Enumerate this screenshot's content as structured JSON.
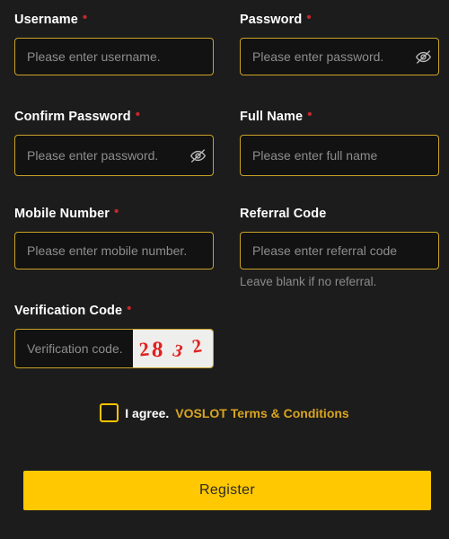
{
  "theme": {
    "page_background": "#1c1c1c",
    "input_background": "#121212",
    "border_gold": "#c9a227",
    "accent_gold": "#ffc400",
    "button_gold": "#ffc800",
    "required_red": "#c62828",
    "captcha_red": "#e02020",
    "captcha_background": "#eeeeec",
    "placeholder_gray": "#8d8d8d",
    "helper_gray": "#8a8a8a"
  },
  "form": {
    "fields": [
      {
        "name": "username",
        "label": "Username",
        "required": true,
        "required_marker": "•",
        "placeholder": "Please enter username.",
        "value": "",
        "has_toggle": false,
        "helper": ""
      },
      {
        "name": "password",
        "label": "Password",
        "required": true,
        "required_marker": "•",
        "placeholder": "Please enter password.",
        "value": "",
        "has_toggle": true,
        "toggle_icon": "eye-slash-icon",
        "helper": ""
      },
      {
        "name": "confirm-password",
        "label": "Confirm Password",
        "required": true,
        "required_marker": "•",
        "placeholder": "Please enter password.",
        "value": "",
        "has_toggle": true,
        "toggle_icon": "eye-slash-icon",
        "helper": ""
      },
      {
        "name": "full-name",
        "label": "Full Name",
        "required": true,
        "required_marker": "•",
        "placeholder": "Please enter full name",
        "value": "",
        "has_toggle": false,
        "helper": ""
      },
      {
        "name": "mobile-number",
        "label": "Mobile Number",
        "required": true,
        "required_marker": "•",
        "placeholder": "Please enter mobile number.",
        "value": "",
        "has_toggle": false,
        "helper": ""
      },
      {
        "name": "referral-code",
        "label": "Referral Code",
        "required": false,
        "required_marker": "",
        "placeholder": "Please enter referral code",
        "value": "",
        "has_toggle": false,
        "helper": "Leave blank if no referral."
      }
    ],
    "verification": {
      "label": "Verification Code",
      "required": true,
      "required_marker": "•",
      "placeholder": "Verification code.",
      "value": "",
      "captcha": {
        "text": "2832",
        "digits": [
          "2",
          "8",
          "3",
          "2"
        ]
      }
    },
    "agreement": {
      "checked": false,
      "prefix": "I agree.",
      "link_label": "VOSLOT Terms & Conditions"
    },
    "submit": {
      "label": "Register"
    }
  }
}
